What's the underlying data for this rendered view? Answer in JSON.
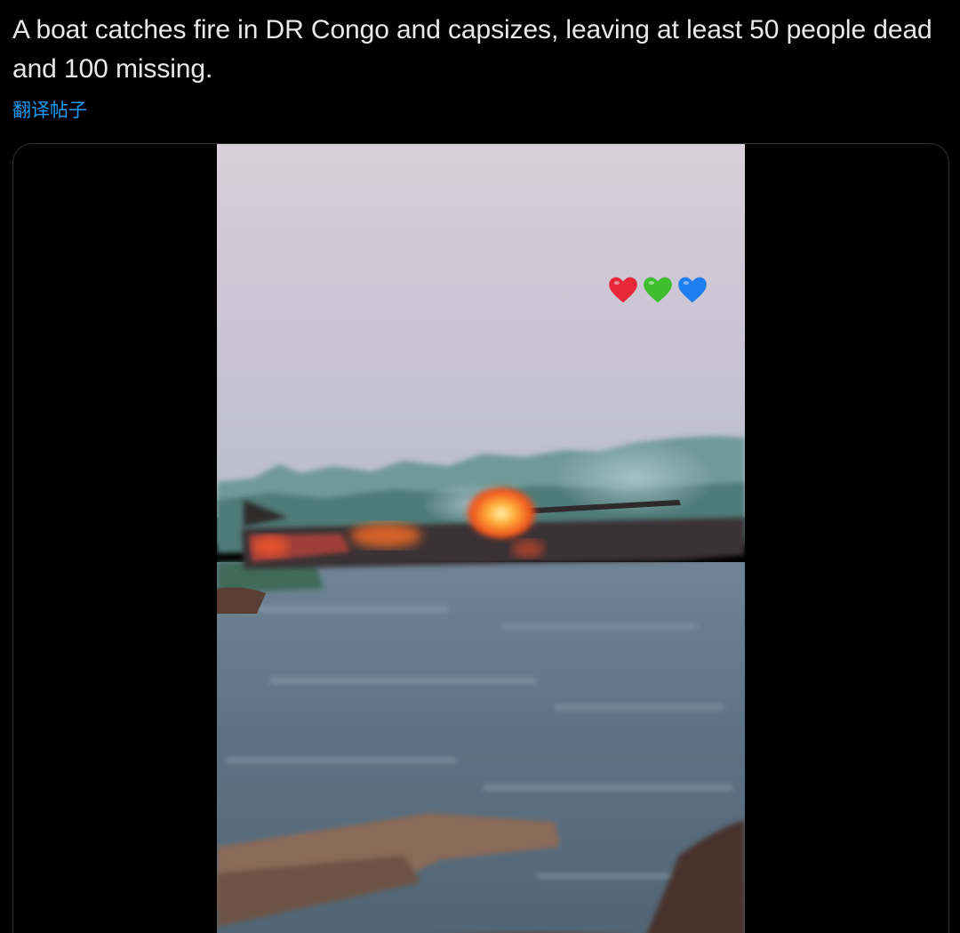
{
  "tweet": {
    "text": "A boat catches fire in DR Congo and capsizes, leaving at least 50 people dead and 100 missing.",
    "translate_label": "翻译帖子"
  },
  "media": {
    "type": "video",
    "overlay_emojis": [
      "red-heart-emoji",
      "green-heart-emoji",
      "blue-heart-emoji"
    ]
  },
  "colors": {
    "background": "#000000",
    "text": "#e7e9ea",
    "link": "#1d9bf0",
    "card_border": "#2f3336",
    "heart_red": "#e8283a",
    "heart_green": "#3fbf2f",
    "heart_blue": "#1f7ff0"
  }
}
